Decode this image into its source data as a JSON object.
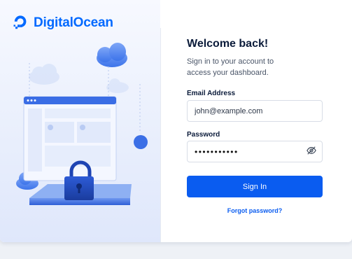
{
  "brand": {
    "name": "DigitalOcean",
    "color": "#0069ff",
    "logo_icon": "digitalocean-logo-icon"
  },
  "login": {
    "title": "Welcome back!",
    "subtitle": "Sign in to your account to access your dashboard.",
    "email": {
      "label": "Email Address",
      "value": "john@example.com"
    },
    "password": {
      "label": "Password",
      "value": "•••••••••••",
      "toggle_icon": "eye-off-icon"
    },
    "submit_label": "Sign In",
    "forgot_label": "Forgot password?"
  },
  "colors": {
    "primary_button": "#0a5cf0",
    "link": "#0a5cf0",
    "heading": "#0b1b3a"
  },
  "illustration": {
    "icons": [
      "cloud-icon",
      "browser-window-icon",
      "padlock-icon",
      "balloon-icon"
    ]
  }
}
